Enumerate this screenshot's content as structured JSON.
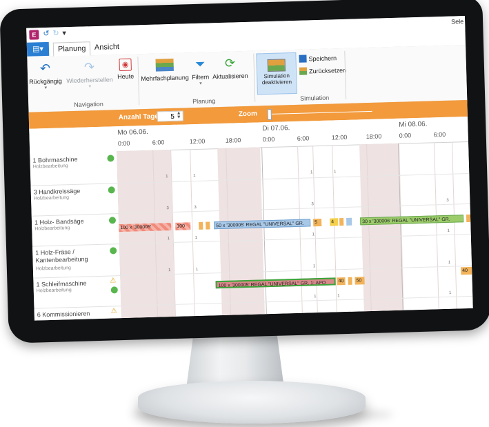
{
  "qat": {
    "app_icon": "E",
    "selection_label": "Sele"
  },
  "tabs": {
    "file_icon": "file-menu-icon",
    "items": [
      "Planung",
      "Ansicht"
    ]
  },
  "ribbon": {
    "undo": "Rückgängig",
    "redo": "Wiederherstellen",
    "today": "Heute",
    "group_navigation": "Navigation",
    "multiplan": "Mehrfachplanung",
    "filter": "Filtern",
    "refresh": "Aktualisieren",
    "group_planning": "Planung",
    "sim_line1": "Simulation",
    "sim_line2": "deaktivieren",
    "save": "Speichern",
    "reset": "Zurücksetzen",
    "group_simulation": "Simulation"
  },
  "strip": {
    "days_label": "Anzahl Tage",
    "days_value": "5",
    "zoom_label": "Zoom"
  },
  "gantt": {
    "days": [
      "Mo 06.06.",
      "Di 07.06.",
      "Mi 08.06."
    ],
    "hours": [
      "0:00",
      "6:00",
      "12:00",
      "18:00",
      "0:00",
      "6:00",
      "12:00",
      "18:00",
      "0:00",
      "6:00"
    ],
    "resources": [
      {
        "name": "1 Bohrmaschine",
        "sub": "Holzbearbeitung"
      },
      {
        "name": "3 Handkreissäge",
        "sub": "Holzbearbeitung"
      },
      {
        "name": "1 Holz- Bandsäge",
        "sub": "Holzbearbeitung"
      },
      {
        "name": "1 Holz-Fräse /",
        "name2": "Kantenbearbeitung",
        "sub": "Holzbearbeitung"
      },
      {
        "name": "1 Schleifmaschine",
        "sub": "Holzbearbeitung"
      },
      {
        "name": "6 Kommissionieren",
        "sub": ""
      }
    ],
    "bars": [
      {
        "label": "100 x '300005'",
        "color": "#f08a7a"
      },
      {
        "label": "100",
        "color": "#f08a7a"
      },
      {
        "label": "50 x '300005' REGAL \"UNIVERSAL\" GR.",
        "color": "#a8c8e8"
      },
      {
        "label": "5",
        "color": "#f2b35a"
      },
      {
        "label": "4",
        "color": "#f4d04c"
      },
      {
        "label": "30 x '300006' REGAL \"UNIVERSAL\" GR.",
        "color": "#9ccc6a"
      },
      {
        "label": "100 x '300005' REGAL \"UNIVERSAL\" GR. 1: APO",
        "color": "#d98a8a"
      },
      {
        "label": "40",
        "color": "#f2b35a"
      },
      {
        "label": "50",
        "color": "#f2b35a"
      },
      {
        "label": "40",
        "color": "#f2b35a"
      }
    ],
    "ticks": [
      "1",
      "3"
    ]
  }
}
